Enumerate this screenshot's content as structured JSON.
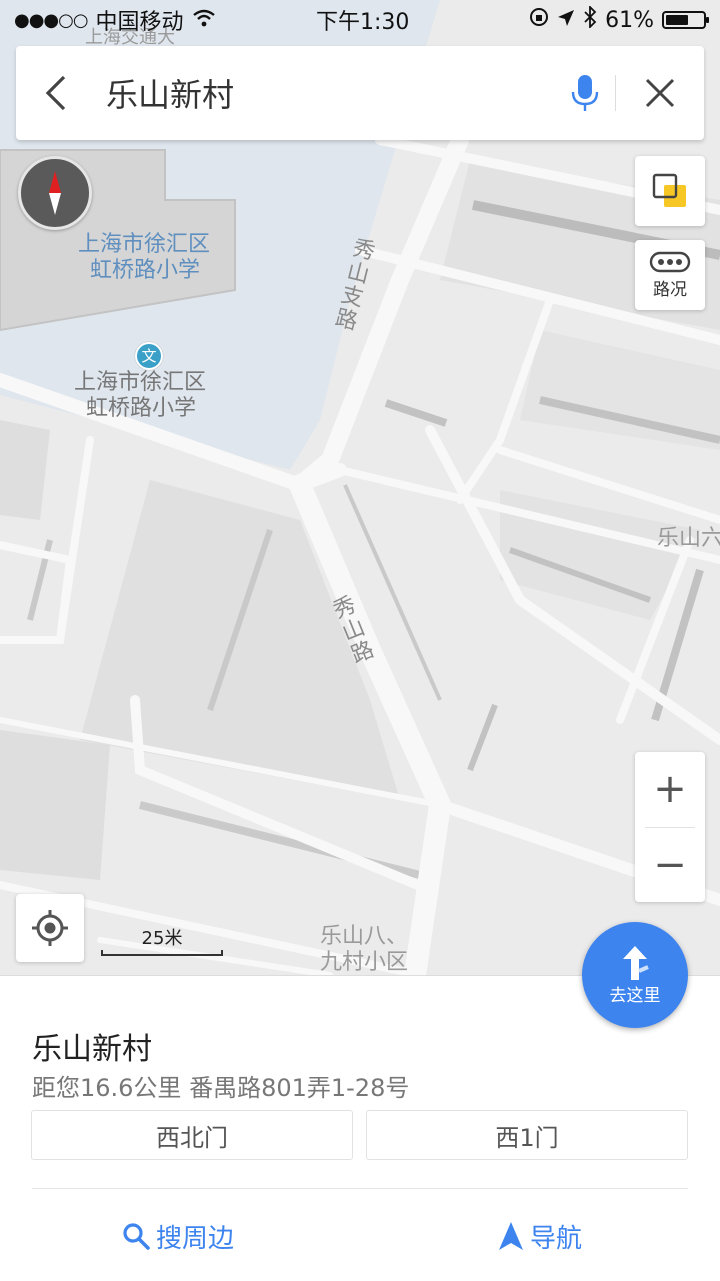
{
  "status_bar": {
    "signal": "●●●○○",
    "carrier": "中国移动",
    "time": "下午1:30",
    "battery_pct": "61%",
    "battery_level": 0.61
  },
  "search": {
    "query": "乐山新村"
  },
  "map": {
    "labels": {
      "top_partial": "上海交通大",
      "school_label_1_line1": "上海市徐汇区",
      "school_label_1_line2": "虹桥路小学",
      "school_poi_icon": "文",
      "school_label_2_line1": "上海市徐汇区",
      "school_label_2_line2": "虹桥路小学",
      "road_xiushan_zhi": "秀山支路",
      "road_xiushan": "秀山路",
      "leshan_right": "乐山六",
      "leshan_bottom_line1": "乐山八、",
      "leshan_bottom_line2": "九村小区"
    },
    "traffic_label": "路况",
    "zoom_in": "+",
    "zoom_out": "−",
    "scale_text": "25米"
  },
  "goto": {
    "label": "去这里"
  },
  "place": {
    "name": "乐山新村",
    "info": "距您16.6公里   番禺路801弄1-28号",
    "gates": [
      "西北门",
      "西1门"
    ],
    "actions": {
      "search_nearby": "搜周边",
      "navigate": "导航"
    }
  },
  "colors": {
    "accent": "#3d84ef",
    "water": "#dfe6ee",
    "map_bg": "#ebebeb"
  }
}
